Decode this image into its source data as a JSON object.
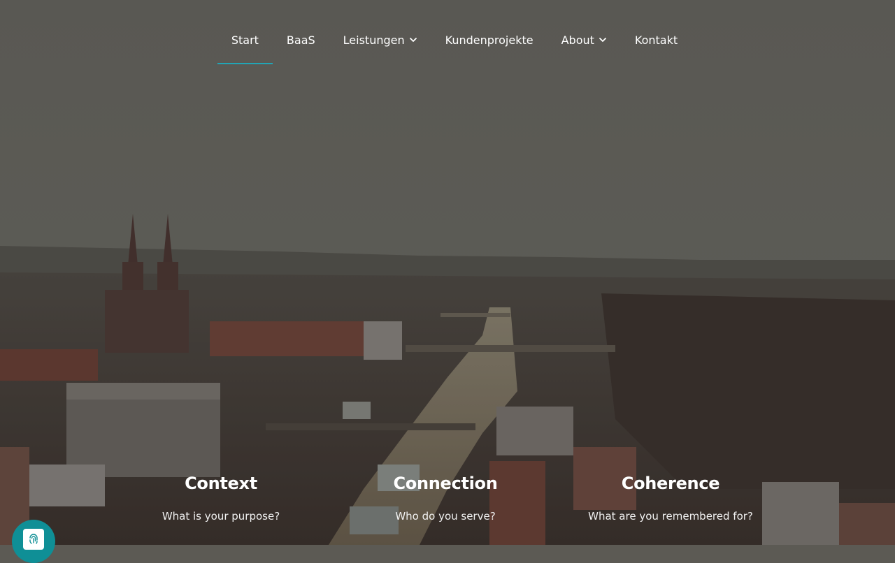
{
  "nav": {
    "items": [
      {
        "label": "Start",
        "active": true,
        "dropdown": false
      },
      {
        "label": "BaaS",
        "active": false,
        "dropdown": false
      },
      {
        "label": "Leistungen",
        "active": false,
        "dropdown": true
      },
      {
        "label": "Kundenprojekte",
        "active": false,
        "dropdown": false
      },
      {
        "label": "About",
        "active": false,
        "dropdown": true
      },
      {
        "label": "Kontakt",
        "active": false,
        "dropdown": false
      }
    ],
    "accent_color": "#21a5b6"
  },
  "pillars": [
    {
      "title": "Context",
      "question": "What is your purpose?"
    },
    {
      "title": "Connection",
      "question": "Who do you serve?"
    },
    {
      "title": "Coherence",
      "question": "What are you remembered for?"
    }
  ],
  "badge": {
    "icon": "fingerprint-icon",
    "color": "#0f8f96"
  }
}
